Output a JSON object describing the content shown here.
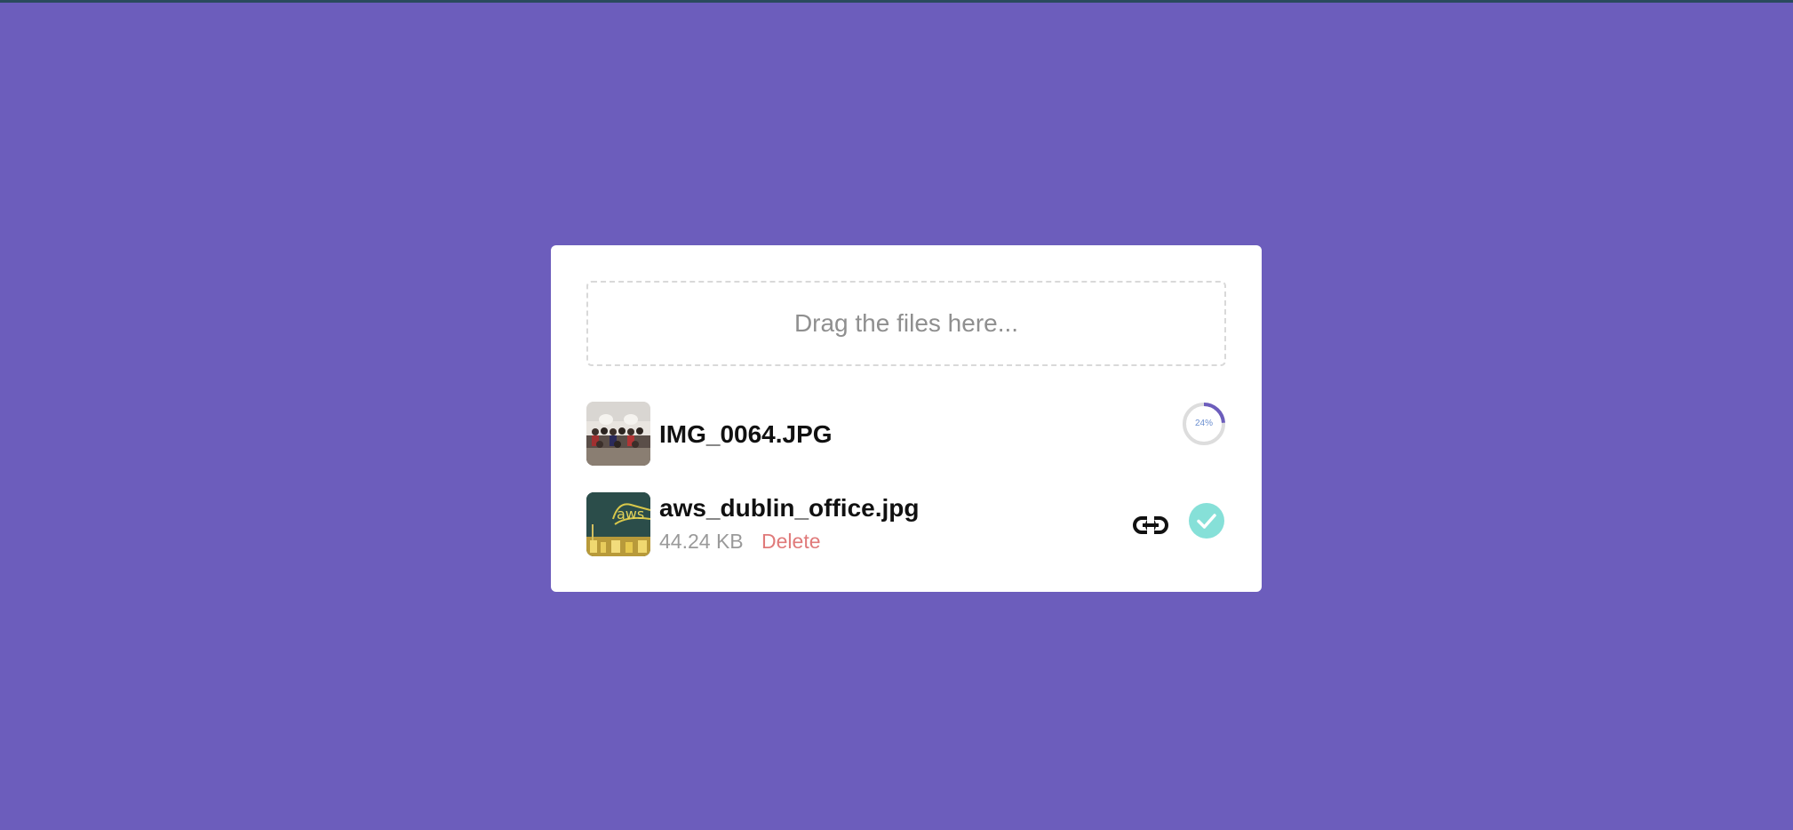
{
  "dropzone": {
    "text": "Drag the files here..."
  },
  "files": [
    {
      "name": "IMG_0064.JPG",
      "progress_label": "24%",
      "progress": 0.24,
      "icon": "thumbnail-image"
    },
    {
      "name": "aws_dublin_office.jpg",
      "size": "44.24 KB",
      "delete_label": "Delete",
      "icons": [
        "thumbnail-image",
        "link-icon",
        "check-icon"
      ]
    }
  ],
  "colors": {
    "background": "#6c5dbc",
    "card": "#ffffff",
    "accent": "#6c5dbc",
    "delete": "#e07a7a",
    "success": "#86e0d8"
  }
}
